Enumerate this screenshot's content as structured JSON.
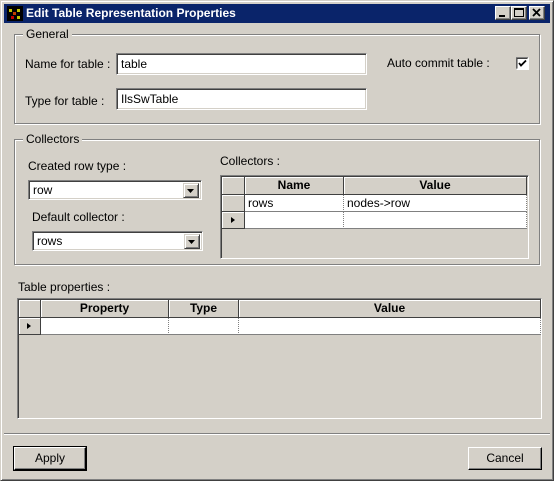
{
  "window": {
    "title": "Edit Table Representation Properties",
    "controls": [
      "minimize",
      "maximize",
      "close"
    ]
  },
  "general": {
    "legend": "General",
    "name_label": "Name for table :",
    "name_value": "table",
    "type_label": "Type for table :",
    "type_value": "IlsSwTable",
    "auto_commit_label": "Auto commit table :",
    "auto_commit_checked": true
  },
  "collectors": {
    "legend": "Collectors",
    "created_row_type_label": "Created row type :",
    "created_row_type_value": "row",
    "default_collector_label": "Default collector :",
    "default_collector_value": "rows",
    "collectors_label": "Collectors :",
    "columns": [
      "Name",
      "Value"
    ],
    "rows": [
      {
        "name": "rows",
        "value": "nodes->row"
      }
    ]
  },
  "table_properties": {
    "label": "Table properties :",
    "columns": [
      "Property",
      "Type",
      "Value"
    ]
  },
  "buttons": {
    "apply": "Apply",
    "cancel": "Cancel"
  }
}
